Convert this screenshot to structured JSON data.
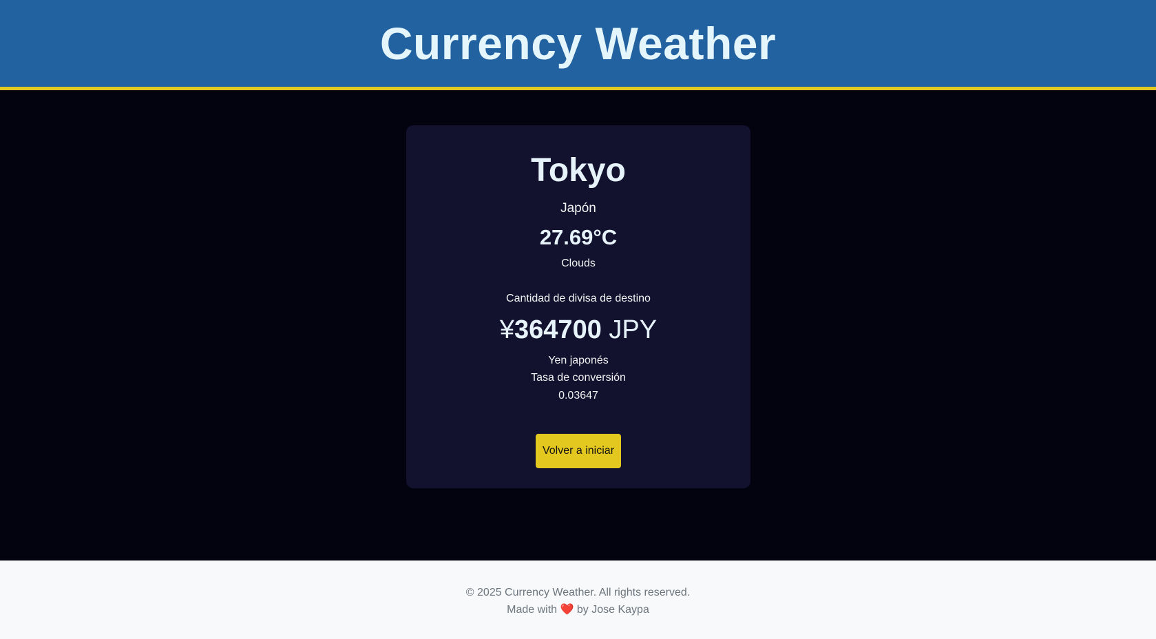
{
  "header": {
    "title": "Currency Weather"
  },
  "card": {
    "city": "Tokyo",
    "country": "Japón",
    "temperature": "27.69°C",
    "weather": "Clouds",
    "amount_label": "Cantidad de divisa de destino",
    "currency_symbol": "¥",
    "amount_value": "364700",
    "currency_code": "JPY",
    "currency_name": "Yen japonés",
    "rate_label": "Tasa de conversión",
    "rate_value": "0.03647",
    "restart_button": "Volver a iniciar"
  },
  "footer": {
    "copyright": "© 2025 Currency Weather. All rights reserved.",
    "made_with_prefix": "Made with",
    "heart_icon": "heart-icon",
    "made_with_suffix": "by Jose Kaypa"
  },
  "colors": {
    "header_bg": "#2362a0",
    "accent_yellow": "#e3c820",
    "page_bg": "#02030f",
    "card_bg": "#12122e",
    "footer_bg": "#f8f9fa",
    "heart": "#e0262b"
  }
}
